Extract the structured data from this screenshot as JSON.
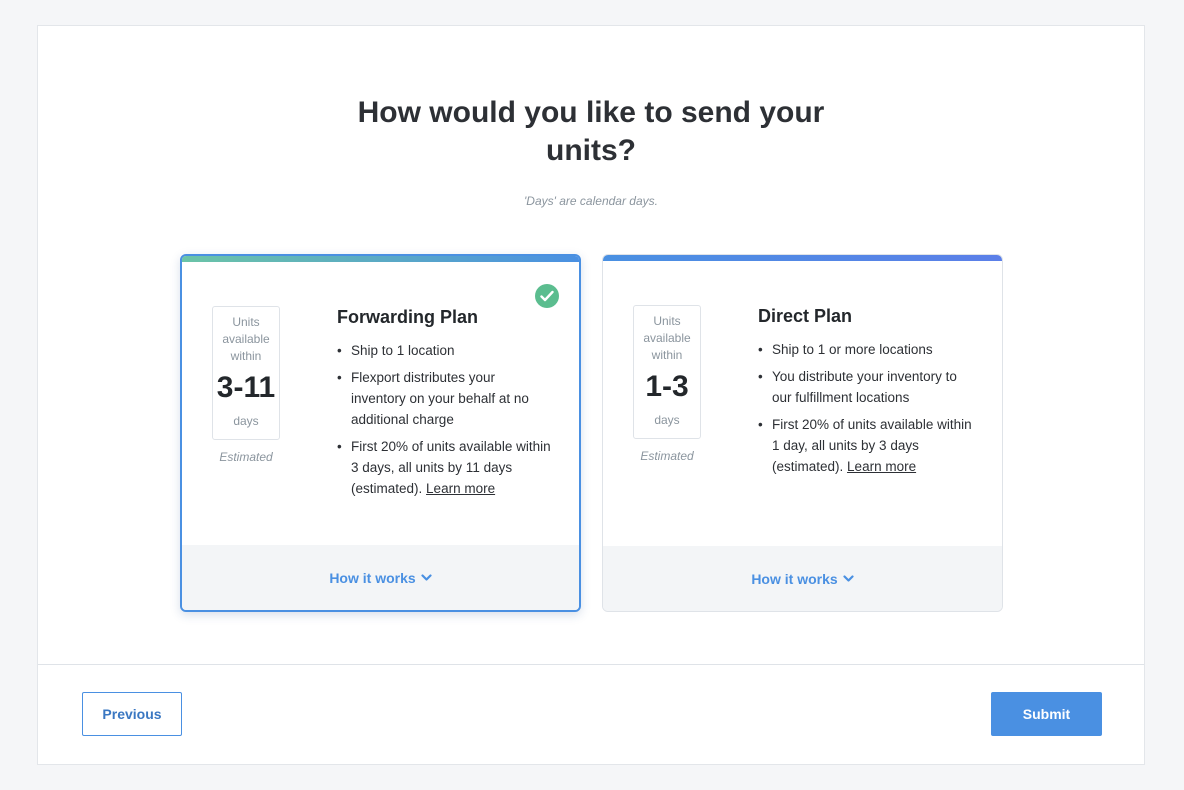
{
  "heading": "How would you like to send your units?",
  "note": "'Days' are calendar days.",
  "colors": {
    "accent": "#4a90e2",
    "success": "#5bbd8f"
  },
  "plans": [
    {
      "title": "Forwarding Plan",
      "selected": true,
      "daybox_top": "Units available within",
      "days": "3-11",
      "days_unit": "days",
      "estimated": "Estimated",
      "bullets": [
        "Ship to 1 location",
        "Flexport distributes your inventory on your behalf at no additional charge",
        "First 20% of units available within 3 days, all units by 11 days (estimated)."
      ],
      "learn_more": "Learn more",
      "how_it_works": "How it works"
    },
    {
      "title": "Direct Plan",
      "selected": false,
      "daybox_top": "Units available within",
      "days": "1-3",
      "days_unit": "days",
      "estimated": "Estimated",
      "bullets": [
        "Ship to 1 or more locations",
        "You distribute your inventory to our fulfillment locations",
        "First 20% of units available within 1 day, all units by 3 days (estimated)."
      ],
      "learn_more": "Learn more",
      "how_it_works": "How it works"
    }
  ],
  "buttons": {
    "previous": "Previous",
    "submit": "Submit"
  },
  "icons": {
    "selected": "check-circle-icon",
    "expand": "chevron-down-icon"
  }
}
